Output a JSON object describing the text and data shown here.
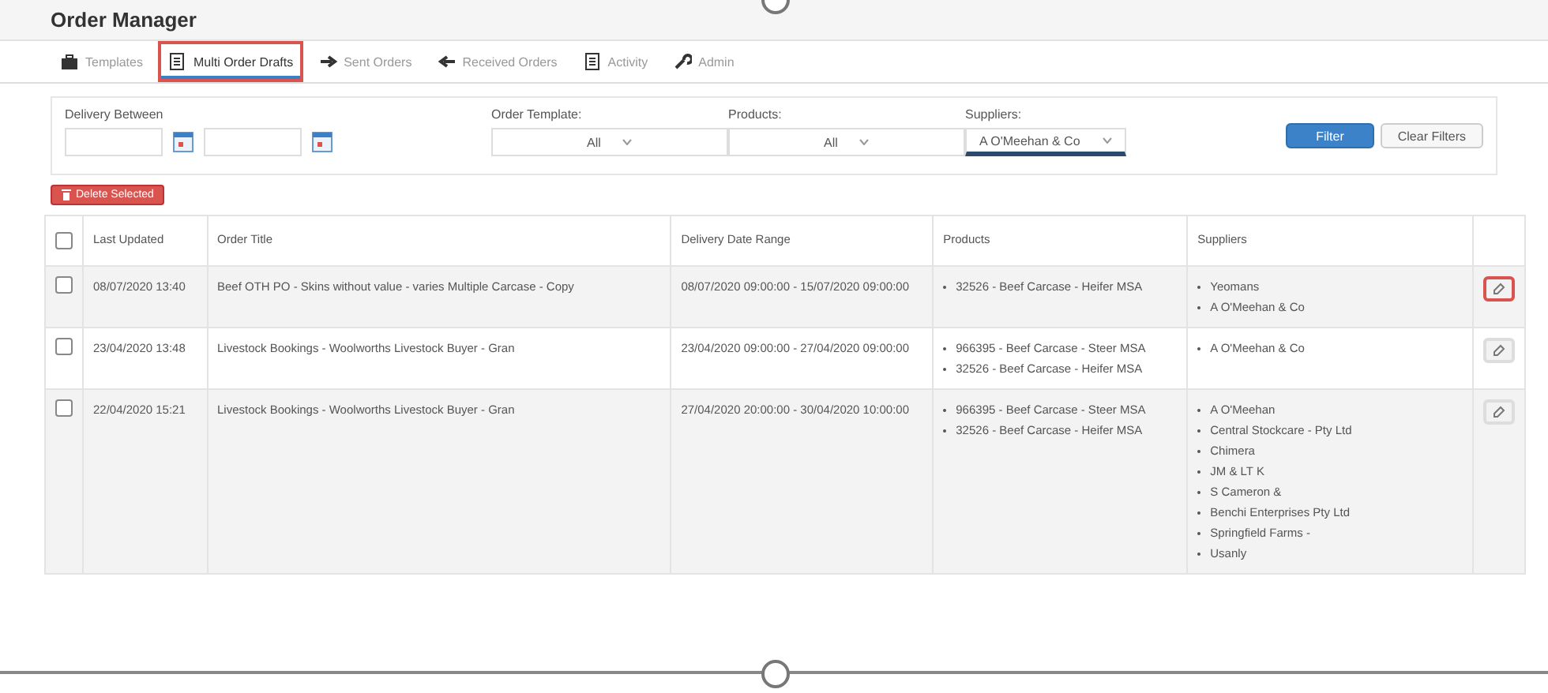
{
  "header": {
    "title": "Order Manager"
  },
  "tabs": [
    {
      "label": "Templates",
      "selected": false,
      "highlighted": false
    },
    {
      "label": "Multi Order Drafts",
      "selected": true,
      "highlighted": true
    },
    {
      "label": "Sent Orders",
      "selected": false,
      "highlighted": false
    },
    {
      "label": "Received Orders",
      "selected": false,
      "highlighted": false
    },
    {
      "label": "Activity",
      "selected": false,
      "highlighted": false
    },
    {
      "label": "Admin",
      "selected": false,
      "highlighted": false
    }
  ],
  "filters": {
    "delivery_between": {
      "label": "Delivery Between"
    },
    "order_template": {
      "label": "Order Template:",
      "value": "All"
    },
    "products": {
      "label": "Products:",
      "value": "All"
    },
    "suppliers": {
      "label": "Suppliers:",
      "value": "A O'Meehan & Co"
    },
    "buttons": [
      {
        "label": "Filter",
        "kind": "primary"
      },
      {
        "label": "Clear Filters",
        "kind": "default"
      }
    ]
  },
  "delete_button": {
    "label": "Delete Selected"
  },
  "table": {
    "select_all": {
      "checked": false
    },
    "columns": [
      "Last Updated",
      "Order Title",
      "Delivery Date Range",
      "Products",
      "Suppliers"
    ],
    "rows": [
      {
        "checked": false,
        "highlighted": true,
        "last_updated": "08/07/2020 13:40",
        "order_title": "Beef OTH PO - Skins without value - varies Multiple Carcase - Copy",
        "date_range": "08/07/2020 09:00:00 - 15/07/2020 09:00:00",
        "products": [
          "32526 - Beef Carcase - Heifer MSA"
        ],
        "suppliers": [
          "Yeomans",
          "A O'Meehan & Co"
        ]
      },
      {
        "checked": false,
        "highlighted": false,
        "last_updated": "23/04/2020 13:48",
        "order_title": "Livestock Bookings - Woolworths Livestock Buyer - Gran",
        "date_range": "23/04/2020 09:00:00 - 27/04/2020 09:00:00",
        "products": [
          "966395 - Beef Carcase - Steer MSA",
          "32526 - Beef Carcase - Heifer MSA"
        ],
        "suppliers": [
          "A O'Meehan & Co"
        ]
      },
      {
        "checked": false,
        "highlighted": false,
        "last_updated": "22/04/2020 15:21",
        "order_title": "Livestock Bookings - Woolworths Livestock Buyer - Gran",
        "date_range": "27/04/2020 20:00:00 - 30/04/2020 10:00:00",
        "products": [
          "966395 - Beef Carcase - Steer MSA",
          "32526 - Beef Carcase - Heifer MSA"
        ],
        "suppliers": [
          "A O'Meehan",
          "Central Stockcare - Pty Ltd",
          "Chimera",
          "JM & LT K",
          "S Cameron &",
          "Benchi Enterprises Pty Ltd",
          "Springfield Farms -",
          "Usanly"
        ]
      }
    ]
  }
}
